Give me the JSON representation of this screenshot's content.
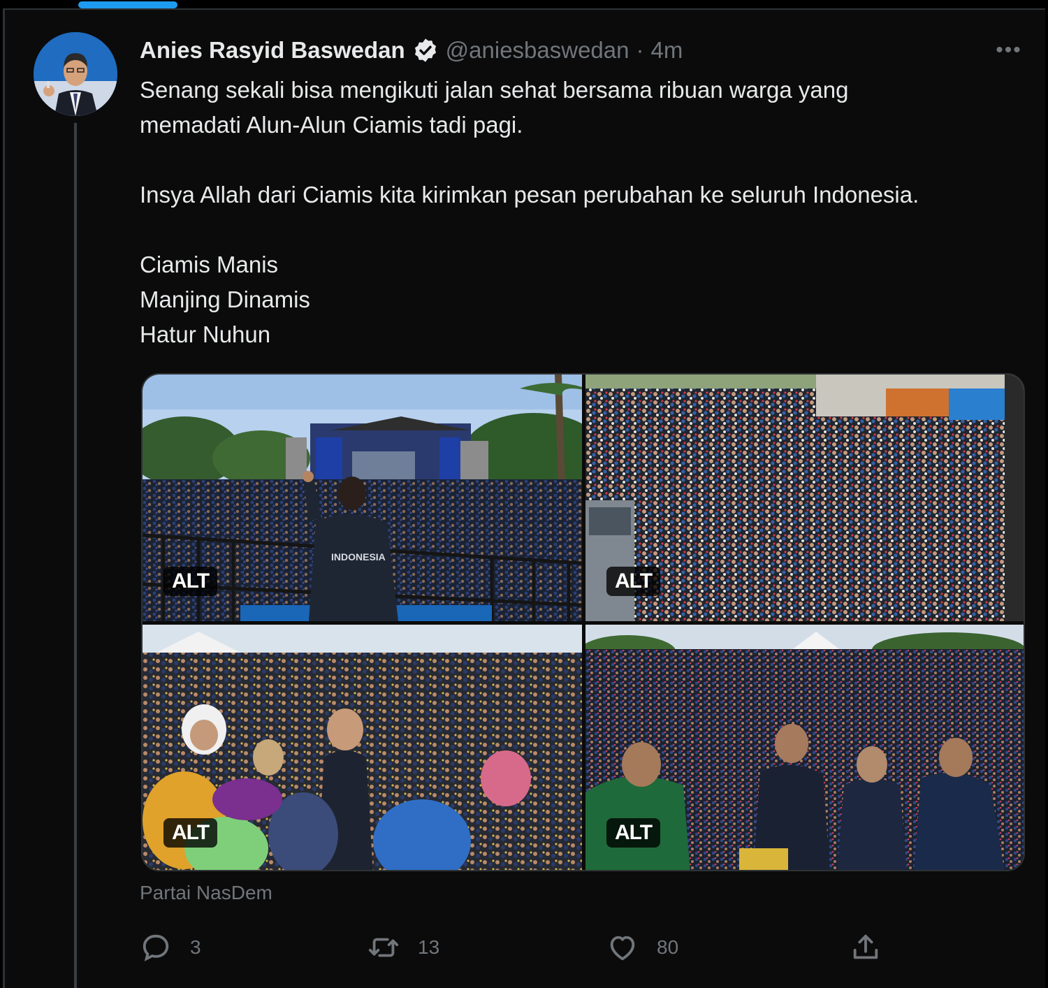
{
  "tweet": {
    "author_name": "Anies Rasyid Baswedan",
    "handle": "@aniesbaswedan",
    "separator": "·",
    "time": "4m",
    "more_label": "•••",
    "lines": {
      "line1": "Senang sekali bisa mengikuti jalan sehat bersama ribuan warga yang",
      "line2": "memadati Alun-Alun Ciamis tadi pagi.",
      "line3": "Insya Allah dari Ciamis kita kirimkan pesan perubahan ke seluruh Indonesia.",
      "line4": "Ciamis Manis",
      "line5": "Manjing Dinamis",
      "line6": "Hatur Nuhun"
    },
    "media": {
      "alt_labels": [
        "ALT",
        "ALT",
        "ALT",
        "ALT"
      ],
      "shirt_text": "INDONESIA"
    },
    "source": "Partai NasDem",
    "actions": {
      "reply_count": "3",
      "retweet_count": "13",
      "like_count": "80"
    }
  },
  "icons": {
    "verified": "verified-badge-icon",
    "reply": "reply-icon",
    "retweet": "retweet-icon",
    "like": "heart-icon",
    "share": "share-icon",
    "more": "more-icon"
  },
  "colors": {
    "background": "#000000",
    "panel": "#0b0b0b",
    "text": "#e7e9ea",
    "muted": "#71767b",
    "accent": "#1d9bf0"
  }
}
